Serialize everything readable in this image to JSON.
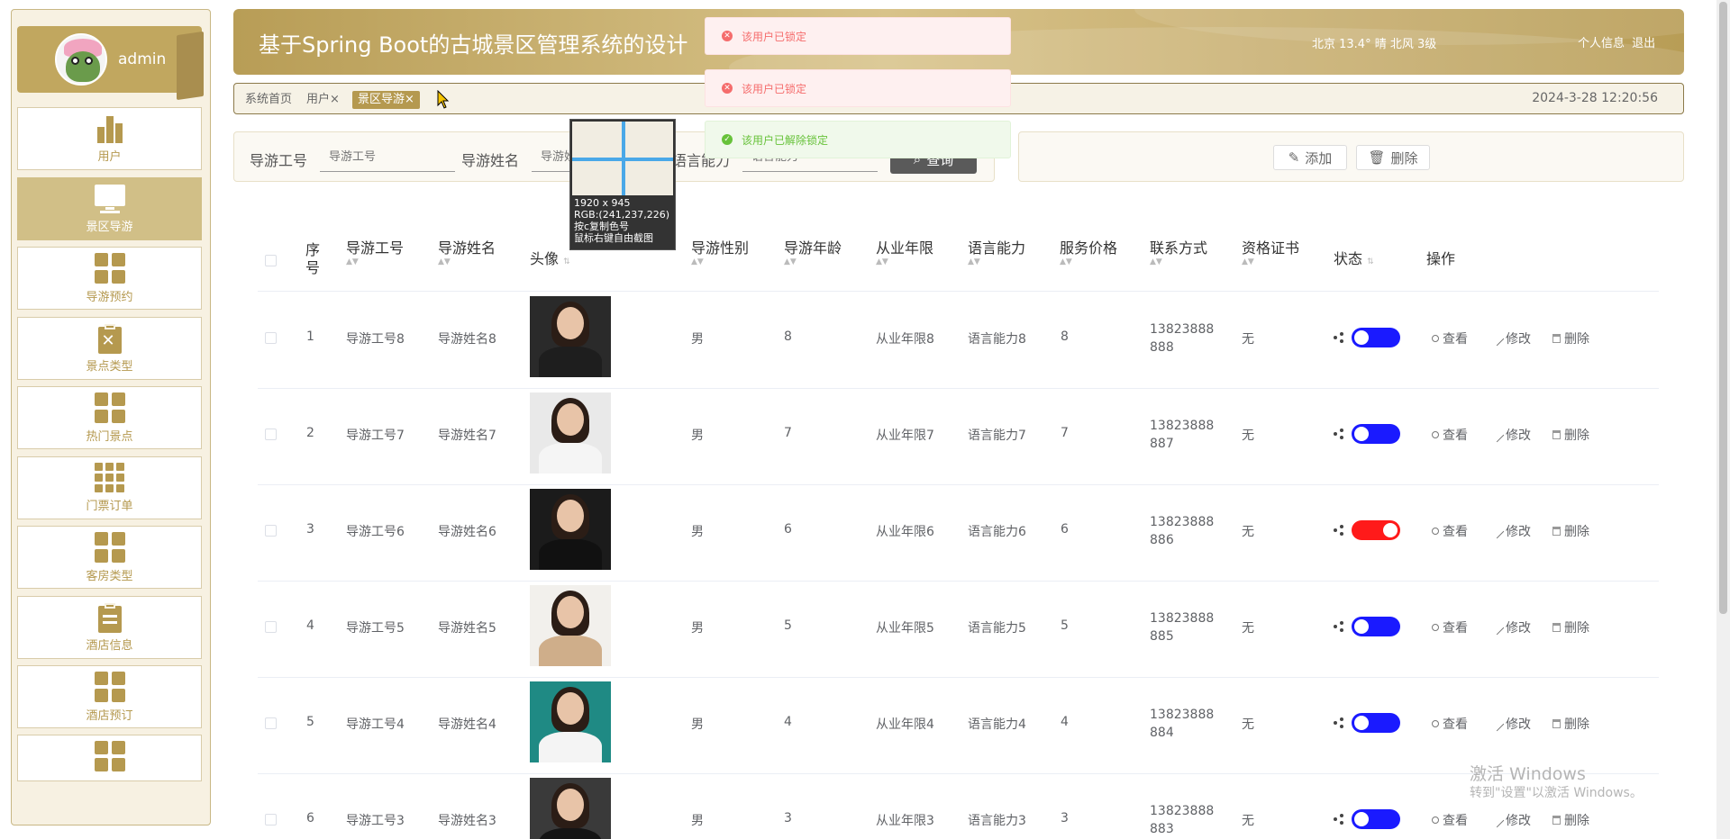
{
  "user": {
    "name": "admin"
  },
  "sidebar": {
    "items": [
      {
        "label": "用户",
        "icon": "bar-chart-icon"
      },
      {
        "label": "景区导游",
        "icon": "monitor-icon",
        "active": true
      },
      {
        "label": "导游预约",
        "icon": "grid-icon"
      },
      {
        "label": "景点类型",
        "icon": "clipboard-x-icon"
      },
      {
        "label": "热门景点",
        "icon": "grid-icon"
      },
      {
        "label": "门票订单",
        "icon": "grid-nine-icon"
      },
      {
        "label": "客房类型",
        "icon": "grid-icon"
      },
      {
        "label": "酒店信息",
        "icon": "clipboard-icon"
      },
      {
        "label": "酒店预订",
        "icon": "grid-icon"
      },
      {
        "label": "",
        "icon": "grid-icon"
      }
    ]
  },
  "header": {
    "title": "基于Spring Boot的古城景区管理系统的设计",
    "weather": "北京  13.4°  晴  北风  3级",
    "profile_link": "个人信息",
    "logout_link": "退出"
  },
  "tabs": {
    "home": "系统首页",
    "user": "用户×",
    "guide": "景区导游×",
    "datetime": "2024-3-28 12:20:56"
  },
  "search": {
    "id_label": "导游工号",
    "id_placeholder": "导游工号",
    "name_label": "导游姓名",
    "name_placeholder": "导游姓名",
    "lang_label": "语言能力",
    "lang_placeholder": "语言能力",
    "button": "查询"
  },
  "actions": {
    "add": "添加",
    "delete": "删除"
  },
  "picker": {
    "size": "1920 x 945",
    "rgb": "RGB:(241,237,226)",
    "hint1": "按c复制色号",
    "hint2": "鼠标右键自由截图",
    "color": "#f1ede2"
  },
  "toasts": [
    {
      "type": "error",
      "text": "该用户已锁定"
    },
    {
      "type": "error",
      "text": "该用户已锁定"
    },
    {
      "type": "success",
      "text": "该用户已解除锁定"
    }
  ],
  "table": {
    "headers": {
      "index": "序号",
      "id": "导游工号",
      "name": "导游姓名",
      "avatar": "头像",
      "gender": "导游性别",
      "age": "导游年龄",
      "years": "从业年限",
      "lang": "语言能力",
      "price": "服务价格",
      "phone": "联系方式",
      "cert": "资格证书",
      "status": "状态",
      "ops": "操作"
    },
    "op_labels": {
      "view": "查看",
      "edit": "修改",
      "delete": "删除"
    },
    "rows": [
      {
        "index": "1",
        "id": "导游工号8",
        "name": "导游姓名8",
        "gender": "男",
        "age": "8",
        "years": "从业年限8",
        "lang": "语言能力8",
        "price": "8",
        "phone": "13823888888",
        "cert": "无",
        "status_on": false,
        "switch_color": "#1a1aff",
        "photo_bg": "#2a2a2a",
        "photo_body": "#1e1e1e"
      },
      {
        "index": "2",
        "id": "导游工号7",
        "name": "导游姓名7",
        "gender": "男",
        "age": "7",
        "years": "从业年限7",
        "lang": "语言能力7",
        "price": "7",
        "phone": "13823888887",
        "cert": "无",
        "status_on": false,
        "switch_color": "#1a1aff",
        "photo_bg": "#e9e9e9",
        "photo_body": "#f5f5f5"
      },
      {
        "index": "3",
        "id": "导游工号6",
        "name": "导游姓名6",
        "gender": "男",
        "age": "6",
        "years": "从业年限6",
        "lang": "语言能力6",
        "price": "6",
        "phone": "13823888886",
        "cert": "无",
        "status_on": true,
        "switch_color": "#ff1a1a",
        "photo_bg": "#1b1b1b",
        "photo_body": "#111111"
      },
      {
        "index": "4",
        "id": "导游工号5",
        "name": "导游姓名5",
        "gender": "男",
        "age": "5",
        "years": "从业年限5",
        "lang": "语言能力5",
        "price": "5",
        "phone": "13823888885",
        "cert": "无",
        "status_on": false,
        "switch_color": "#1a1aff",
        "photo_bg": "#f2f0ec",
        "photo_body": "#cfae8a"
      },
      {
        "index": "5",
        "id": "导游工号4",
        "name": "导游姓名4",
        "gender": "男",
        "age": "4",
        "years": "从业年限4",
        "lang": "语言能力4",
        "price": "4",
        "phone": "13823888884",
        "cert": "无",
        "status_on": false,
        "switch_color": "#1a1aff",
        "photo_bg": "#1f8a84",
        "photo_body": "#f4f4f4"
      },
      {
        "index": "6",
        "id": "导游工号3",
        "name": "导游姓名3",
        "gender": "男",
        "age": "3",
        "years": "从业年限3",
        "lang": "语言能力3",
        "price": "3",
        "phone": "13823888883",
        "cert": "无",
        "status_on": false,
        "switch_color": "#1a1aff",
        "photo_bg": "#3a3a3a",
        "photo_body": "#151515"
      }
    ]
  },
  "watermark": {
    "line1": "激活 Windows",
    "line2": "转到\"设置\"以激活 Windows。"
  },
  "colors": {
    "accent": "#b5994f",
    "header": "#c9b072"
  }
}
